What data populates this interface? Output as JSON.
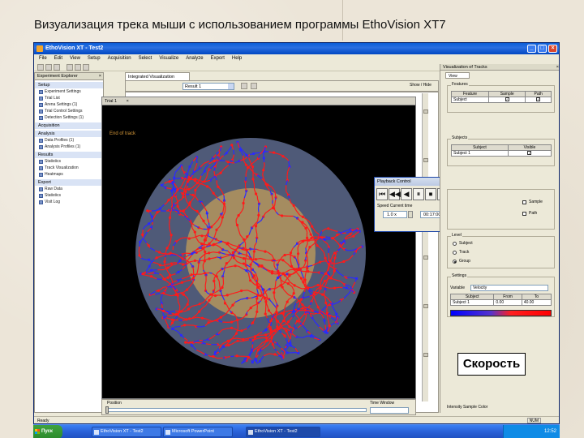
{
  "slide": {
    "title": "Визуализация трека мыши с использованием программы EthoVision XT7",
    "speed_label": "Скорость"
  },
  "window": {
    "title": "EthoVision XT - Test2",
    "menu": [
      "File",
      "Edit",
      "View",
      "Setup",
      "Acquisition",
      "Select",
      "Visualize",
      "Analyze",
      "Export",
      "Help"
    ]
  },
  "explorer": {
    "title": "Experiment Explorer",
    "groups": [
      {
        "label": "Setup",
        "items": [
          "Experiment Settings",
          "Trial List",
          "Arena Settings (1)",
          "Trial Control Settings",
          "Detection Settings (1)"
        ]
      },
      {
        "label": "Acquisition",
        "items": []
      },
      {
        "label": "Analysis",
        "items": [
          "Data Profiles (1)",
          "Analysis Profiles (1)"
        ]
      },
      {
        "label": "Results",
        "items": [
          "Statistics",
          "Track Visualization",
          "Heatmaps"
        ]
      },
      {
        "label": "Export",
        "items": [
          "Raw Data",
          "Statistics",
          "Visit Log"
        ]
      }
    ]
  },
  "document": {
    "tab": "Integrated Visualization",
    "result_select": "Result 1",
    "show_button": "Show / Hide"
  },
  "trial_window": {
    "title": "Trial 1",
    "end_of_track": "End of track"
  },
  "position_bar": {
    "position_label": "Position",
    "time_label": "Time Window"
  },
  "playback": {
    "title": "Playback Control",
    "buttons": [
      "⏮",
      "◀◀",
      "◀",
      "⏸",
      "⏹",
      "▶",
      "▶▶",
      "⏭"
    ],
    "speed_label": "Speed   Current time",
    "speed_value": "1.0 x",
    "time_value": "00:17:00.0"
  },
  "viz_panel": {
    "title": "Visualization of Tracks",
    "tab": "View",
    "features_label": "Features",
    "features_header": [
      "Feature",
      "Sample",
      "Path"
    ],
    "features_rows": [
      {
        "name": "Subject",
        "sample": "✓",
        "path": "✓"
      }
    ],
    "subjects_label": "Subjects",
    "subjects_header": [
      "Subject",
      "Visible"
    ],
    "subjects_rows": [
      {
        "name": "Subject 1",
        "visible": "✓"
      }
    ],
    "options": [
      "Sample",
      "Path"
    ],
    "level_label": "Level",
    "level_options": [
      "Subject",
      "Track",
      "Group"
    ],
    "settings_label": "Settings",
    "variable_label": "Variable",
    "variable_value": "Velocity",
    "range_header": [
      "Subject",
      "From",
      "To"
    ],
    "range_row": {
      "subject": "Subject 1",
      "from": "0.00",
      "to": "40.00"
    },
    "footer": "Intensity Sample Color"
  },
  "status": {
    "left": "Ready",
    "right": "NUM"
  },
  "taskbar": {
    "start": "Пуск",
    "buttons": [
      "EthoVision XT - Test2",
      "Microsoft PowerPoint",
      "EthoVision XT - Test2"
    ],
    "clock": "12:52"
  },
  "colors": {
    "arena_outer": "#4f5a78",
    "arena_inner": "#a58c60",
    "track_fast": "#ff1a1a",
    "track_slow": "#2a2aff",
    "titlebar_blue": "#0a5ed8"
  }
}
